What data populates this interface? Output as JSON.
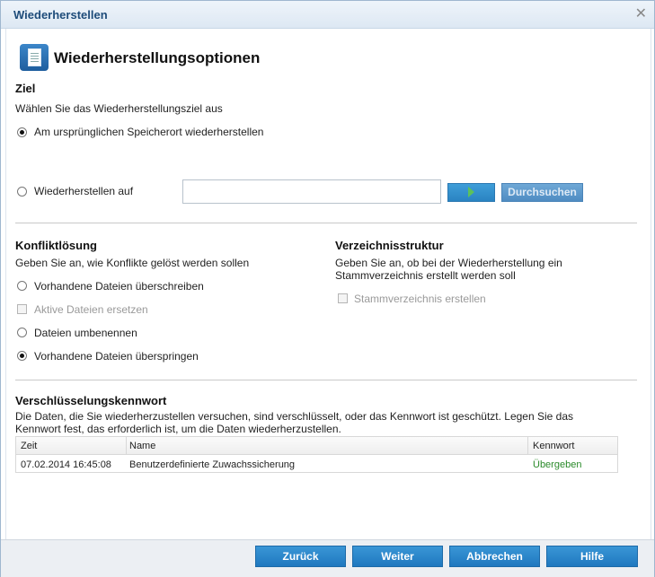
{
  "window": {
    "title": "Wiederherstellen",
    "close_glyph": "✕"
  },
  "header": {
    "title": "Wiederherstellungsoptionen",
    "icon": "restore-options-icon"
  },
  "destination": {
    "title": "Ziel",
    "description": "Wählen Sie das Wiederherstellungsziel aus",
    "option_original": "Am ursprünglichen Speicherort wiederherstellen",
    "option_restore_to": "Wiederherstellen auf",
    "path_value": "",
    "browse_label": "Durchsuchen",
    "selected": "original"
  },
  "conflict": {
    "title": "Konfliktlösung",
    "description": "Geben Sie an, wie Konflikte gelöst werden sollen",
    "overwrite": "Vorhandene Dateien überschreiben",
    "replace_active": "Aktive Dateien ersetzen",
    "rename": "Dateien umbenennen",
    "skip": "Vorhandene Dateien überspringen",
    "selected": "skip"
  },
  "directory": {
    "title": "Verzeichnisstruktur",
    "description_line1": "Geben Sie an, ob bei der Wiederherstellung ein",
    "description_line2": "Stammverzeichnis erstellt werden soll",
    "create_root": "Stammverzeichnis erstellen"
  },
  "encryption": {
    "title": "Verschlüsselungskennwort",
    "description_line1": "Die Daten, die Sie wiederherzustellen versuchen, sind verschlüsselt, oder das Kennwort ist geschützt. Legen Sie das",
    "description_line2": "Kennwort fest, das erforderlich ist, um die Daten wiederherzustellen.",
    "columns": {
      "time": "Zeit",
      "name": "Name",
      "password": "Kennwort"
    },
    "rows": [
      {
        "time": "07.02.2014 16:45:08",
        "name": "Benutzerdefinierte Zuwachssicherung",
        "password": "Übergeben"
      }
    ]
  },
  "footer": {
    "back": "Zurück",
    "next": "Weiter",
    "cancel": "Abbrechen",
    "help": "Hilfe"
  },
  "colors": {
    "accent": "#1f78bf",
    "title": "#1e4c7a",
    "status_ok": "#2a8a2a"
  }
}
